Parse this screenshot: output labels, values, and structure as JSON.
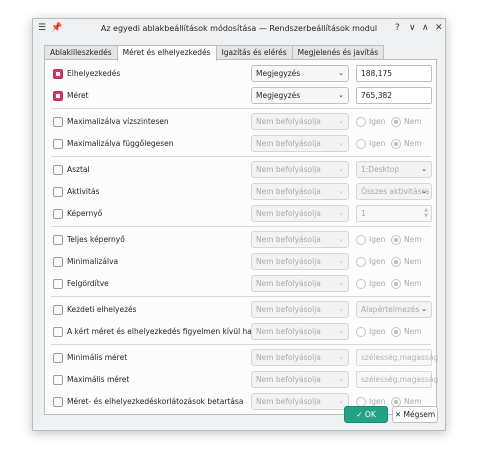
{
  "window": {
    "title": "Az egyedi ablakbeállítások módosítása — Rendszerbeállítások modul",
    "help_btn": "?",
    "min_btn": "∨",
    "max_btn": "∧",
    "close_btn": "✕"
  },
  "tabs": [
    "Ablakilleszkedés",
    "Méret és elhelyezkedés",
    "Igazítás és elérés",
    "Megjelenés és javítás"
  ],
  "rows": {
    "r0": {
      "label": "Elhelyezkedés",
      "policy": "Megjegyzés",
      "value": "188,175"
    },
    "r1": {
      "label": "Méret",
      "policy": "Megjegyzés",
      "value": "765,382"
    },
    "r2": {
      "label": "Maximalizálva vízszintesen",
      "policy": "Nem befolyásolja",
      "yes": "Igen",
      "no": "Nem"
    },
    "r3": {
      "label": "Maximalizálva függőlegesen",
      "policy": "Nem befolyásolja",
      "yes": "Igen",
      "no": "Nem"
    },
    "r4": {
      "label": "Asztal",
      "policy": "Nem befolyásolja",
      "value": "1:Desktop"
    },
    "r5": {
      "label": "Aktivitás",
      "policy": "Nem befolyásolja",
      "value": "Összes aktivitásra"
    },
    "r6": {
      "label": "Képernyő",
      "policy": "Nem befolyásolja",
      "value": "1"
    },
    "r7": {
      "label": "Teljes képernyő",
      "policy": "Nem befolyásolja",
      "yes": "Igen",
      "no": "Nem"
    },
    "r8": {
      "label": "Minimalizálva",
      "policy": "Nem befolyásolja",
      "yes": "Igen",
      "no": "Nem"
    },
    "r9": {
      "label": "Felgördítve",
      "policy": "Nem befolyásolja",
      "yes": "Igen",
      "no": "Nem"
    },
    "r10": {
      "label": "Kezdeti elhelyezés",
      "policy": "Nem befolyásolja",
      "value": "Alapértelmezés"
    },
    "r11": {
      "label": "A kért méret és elhelyezkedés figyelmen kívül hagyása",
      "policy": "Nem befolyásolja",
      "yes": "Igen",
      "no": "Nem"
    },
    "r12": {
      "label": "Minimális méret",
      "policy": "Nem befolyásolja",
      "placeholder": "szélesség,magasság"
    },
    "r13": {
      "label": "Maximális méret",
      "policy": "Nem befolyásolja",
      "placeholder": "szélesség,magasság"
    },
    "r14": {
      "label": "Méret- és elhelyezkedéskorlátozások betartása",
      "policy": "Nem befolyásolja",
      "yes": "Igen",
      "no": "Nem"
    }
  },
  "buttons": {
    "ok": "OK",
    "cancel": "Mégsem"
  },
  "icons": {
    "chevron": "⌄",
    "check": "✓",
    "x": "✕"
  }
}
